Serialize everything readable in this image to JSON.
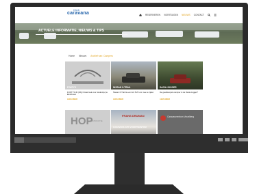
{
  "site": {
    "logo_small": "Club",
    "logo": "caravana",
    "nav": [
      "RESERVEREN",
      "VOERTUIGEN",
      "NIEUWS",
      "CONTACT"
    ],
    "active_nav": "NIEUWS",
    "hero_title": "ACTUELE INFORMATIE, NIEUWS & TIPS"
  },
  "breadcrumb": [
    "Home",
    "Nieuws",
    "Archief van: Campers"
  ],
  "cards": [
    {
      "image_caption": "FONTYS",
      "image_label": "FONTYS VOORTSEINTOM",
      "title": "FONTYS 30 (Wij) Onderzoek voor student(e) te Eindhoven",
      "more": "LEES MEER"
    },
    {
      "image_caption": "NISSAN X-TRAIL",
      "title": "Nissan X-Trail is een 4x4 SUV om mee te rijden",
      "more": "LEES MEER"
    },
    {
      "image_caption": "DACIA JOGGER",
      "title": "De goedkoopste camper is de Dacia Jogger?",
      "more": "LEES MEER"
    },
    {
      "image_caption": "HOP",
      "image_label": "CONSTRUCTIE"
    },
    {
      "image_caption": "CARAVANS APK VOORTSEINTOM",
      "image_label": "FRANS DRUMAN"
    },
    {
      "image_caption": "Caravanzentrum Vorarlberg"
    }
  ],
  "colors": {
    "accent": "#e0a21b",
    "brand": "#1d5fa8",
    "bezel": "#2a2a2a"
  }
}
